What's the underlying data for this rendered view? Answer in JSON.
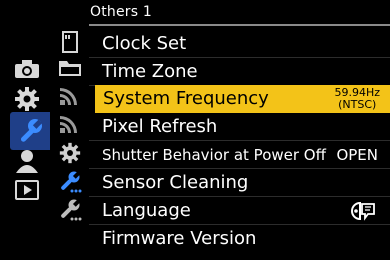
{
  "header": {
    "title": "Others 1"
  },
  "left_tabs": [
    {
      "name": "camera-photo-icon",
      "active": false
    },
    {
      "name": "gear-icon",
      "active": false
    },
    {
      "name": "wrench-icon",
      "active": true
    },
    {
      "name": "person-icon",
      "active": false
    },
    {
      "name": "playback-icon",
      "active": false
    }
  ],
  "sub_tabs": [
    {
      "name": "card-icon"
    },
    {
      "name": "folder-icon"
    },
    {
      "name": "wireless-icon"
    },
    {
      "name": "wireless-icon"
    },
    {
      "name": "gear-icon"
    },
    {
      "name": "wrench-dotted-icon"
    },
    {
      "name": "wrench-dotted-icon"
    }
  ],
  "menu": {
    "items": [
      {
        "label": "Clock Set"
      },
      {
        "label": "Time Zone"
      },
      {
        "label": "System Frequency",
        "value_line1": "59.94Hz",
        "value_line2": "(NTSC)",
        "selected": true
      },
      {
        "label": "Pixel Refresh"
      },
      {
        "label": "Shutter Behavior at Power Off",
        "value": "OPEN"
      },
      {
        "label": "Sensor Cleaning"
      },
      {
        "label": "Language",
        "value_icon": "language-icon"
      },
      {
        "label": "Firmware Version"
      }
    ]
  },
  "colors": {
    "selected_bg": "#f3c318",
    "active_tab_bg": "#1f3f88",
    "accent_blue": "#2e6fe0"
  }
}
